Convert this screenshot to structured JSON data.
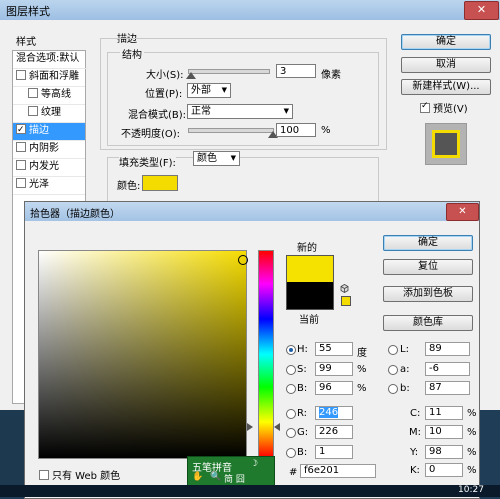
{
  "layer_style": {
    "title": "图层样式",
    "close": "✕",
    "styles_header": "样式",
    "styles": [
      {
        "label": "混合选项:默认",
        "check": false,
        "selected": false,
        "indent": false
      },
      {
        "label": "斜面和浮雕",
        "check": true,
        "checked": false,
        "selected": false,
        "indent": false
      },
      {
        "label": "等高线",
        "check": true,
        "checked": false,
        "selected": false,
        "indent": true
      },
      {
        "label": "纹理",
        "check": true,
        "checked": false,
        "selected": false,
        "indent": true
      },
      {
        "label": "描边",
        "check": true,
        "checked": true,
        "selected": true,
        "indent": false
      },
      {
        "label": "内阴影",
        "check": true,
        "checked": false,
        "selected": false,
        "indent": false
      },
      {
        "label": "内发光",
        "check": true,
        "checked": false,
        "selected": false,
        "indent": false
      },
      {
        "label": "光泽",
        "check": true,
        "checked": false,
        "selected": false,
        "indent": false
      }
    ],
    "stroke_section": "描边",
    "structure_group": "结构",
    "size_label": "大小(S):",
    "size_value": "3",
    "size_unit": "像素",
    "size_slider_fraction": 0.03,
    "position_label": "位置(P):",
    "position_value": "外部",
    "blend_label": "混合模式(B):",
    "blend_value": "正常",
    "opacity_label": "不透明度(O):",
    "opacity_value": "100",
    "opacity_unit": "%",
    "opacity_slider_fraction": 1.0,
    "fill_type_label": "填充类型(F):",
    "fill_type_value": "颜色",
    "color_label": "颜色:",
    "stroke_color": "#f5dc00",
    "ok": "确定",
    "reset": "取消",
    "new_style": "新建样式(W)...",
    "preview_label": "预览(V)",
    "preview_checked": true
  },
  "color_picker": {
    "title": "拾色器（描边颜色）",
    "close": "✕",
    "new_label": "新的",
    "current_label": "当前",
    "new_color": "#f6e201",
    "current_color": "#000000",
    "ok": "确定",
    "reset": "复位",
    "add_swatch": "添加到色板",
    "color_libraries": "颜色库",
    "web_only": "只有 Web 颜色",
    "hsb": [
      {
        "label": "H:",
        "value": "55",
        "unit": "度",
        "selected": true
      },
      {
        "label": "S:",
        "value": "99",
        "unit": "%",
        "selected": false
      },
      {
        "label": "B:",
        "value": "96",
        "unit": "%",
        "selected": false
      }
    ],
    "rgb": [
      {
        "label": "R:",
        "value": "246",
        "selected": false,
        "highlight": true
      },
      {
        "label": "G:",
        "value": "226",
        "selected": false,
        "highlight": false
      },
      {
        "label": "B:",
        "value": "1",
        "selected": false,
        "highlight": false
      }
    ],
    "lab": [
      {
        "label": "L:",
        "value": "89"
      },
      {
        "label": "a:",
        "value": "-6"
      },
      {
        "label": "b:",
        "value": "87"
      }
    ],
    "cmyk": [
      {
        "label": "C:",
        "value": "11",
        "unit": "%"
      },
      {
        "label": "M:",
        "value": "10",
        "unit": "%"
      },
      {
        "label": "Y:",
        "value": "98",
        "unit": "%"
      },
      {
        "label": "K:",
        "value": "0",
        "unit": "%"
      }
    ],
    "hex_label": "#",
    "hex_value": "f6e201"
  },
  "ime": {
    "name": "五笔拼音",
    "mode": "简 囧"
  },
  "taskbar": {
    "time": "10:27"
  }
}
